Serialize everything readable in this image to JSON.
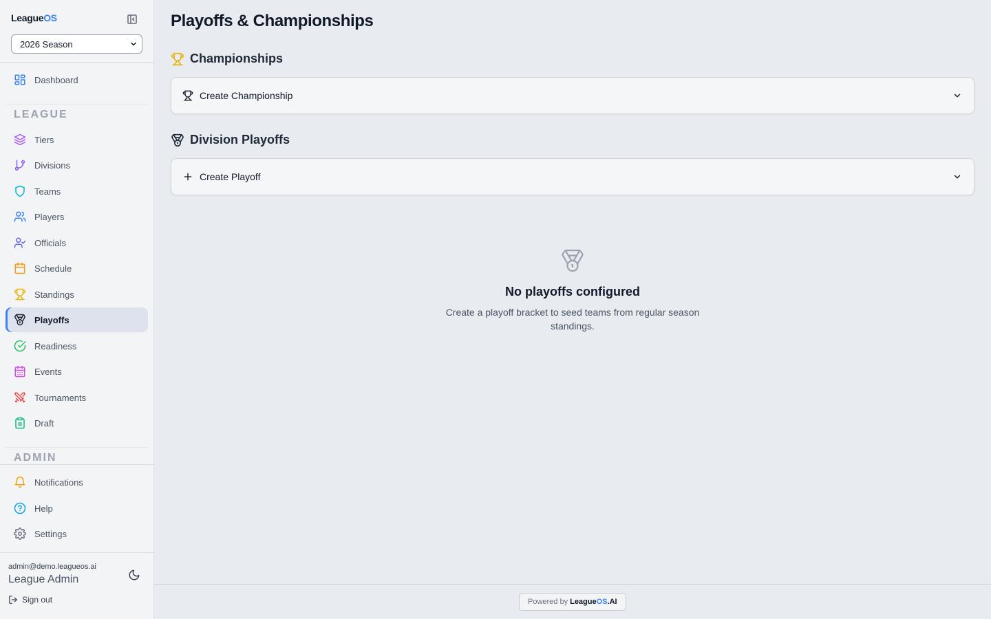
{
  "brand": {
    "name_prefix": "League",
    "name_accent": "OS"
  },
  "season_select": {
    "value": "2026 Season"
  },
  "sidebar": {
    "dashboard": {
      "label": "Dashboard"
    },
    "league_label": "LEAGUE",
    "league_items": [
      {
        "label": "Tiers",
        "icon": "layers-icon",
        "color": "#a855f7"
      },
      {
        "label": "Divisions",
        "icon": "git-branch-icon",
        "color": "#8b5cf6"
      },
      {
        "label": "Teams",
        "icon": "shield-icon",
        "color": "#06b6d4"
      },
      {
        "label": "Players",
        "icon": "users-icon",
        "color": "#3b82f6"
      },
      {
        "label": "Officials",
        "icon": "user-check-icon",
        "color": "#6366f1"
      },
      {
        "label": "Schedule",
        "icon": "calendar-icon",
        "color": "#f59e0b"
      },
      {
        "label": "Standings",
        "icon": "trophy-icon",
        "color": "#eab308"
      },
      {
        "label": "Playoffs",
        "icon": "medal-icon",
        "color": "#1f2937",
        "active": true
      },
      {
        "label": "Readiness",
        "icon": "check-circle-icon",
        "color": "#22c55e"
      },
      {
        "label": "Events",
        "icon": "calendar-days-icon",
        "color": "#d946ef"
      },
      {
        "label": "Tournaments",
        "icon": "swords-icon",
        "color": "#ef4444"
      },
      {
        "label": "Draft",
        "icon": "clipboard-icon",
        "color": "#10b981"
      }
    ],
    "admin_label": "ADMIN",
    "admin_items": [
      {
        "label": "Notifications",
        "icon": "bell-icon",
        "color": "#f59e0b"
      },
      {
        "label": "Help",
        "icon": "help-circle-icon",
        "color": "#0ea5e9"
      },
      {
        "label": "Settings",
        "icon": "gear-icon",
        "color": "#6b7280"
      }
    ]
  },
  "user": {
    "email": "admin@demo.leagueos.ai",
    "name": "League Admin",
    "signout": "Sign out"
  },
  "main": {
    "title": "Playoffs & Championships",
    "championships": {
      "heading": "Championships",
      "accordion": "Create Championship"
    },
    "division_playoffs": {
      "heading": "Division Playoffs",
      "accordion": "Create Playoff"
    },
    "empty": {
      "title": "No playoffs configured",
      "description": "Create a playoff bracket to seed teams from regular season standings."
    }
  },
  "footer": {
    "powered_by": "Powered by",
    "brand_prefix": "League",
    "brand_accent": "OS",
    "brand_suffix": ".AI"
  },
  "colors": {
    "accent": "#3b82f6",
    "sidebar_bg": "#f3f4f6",
    "active_bg": "#dde2ed"
  }
}
